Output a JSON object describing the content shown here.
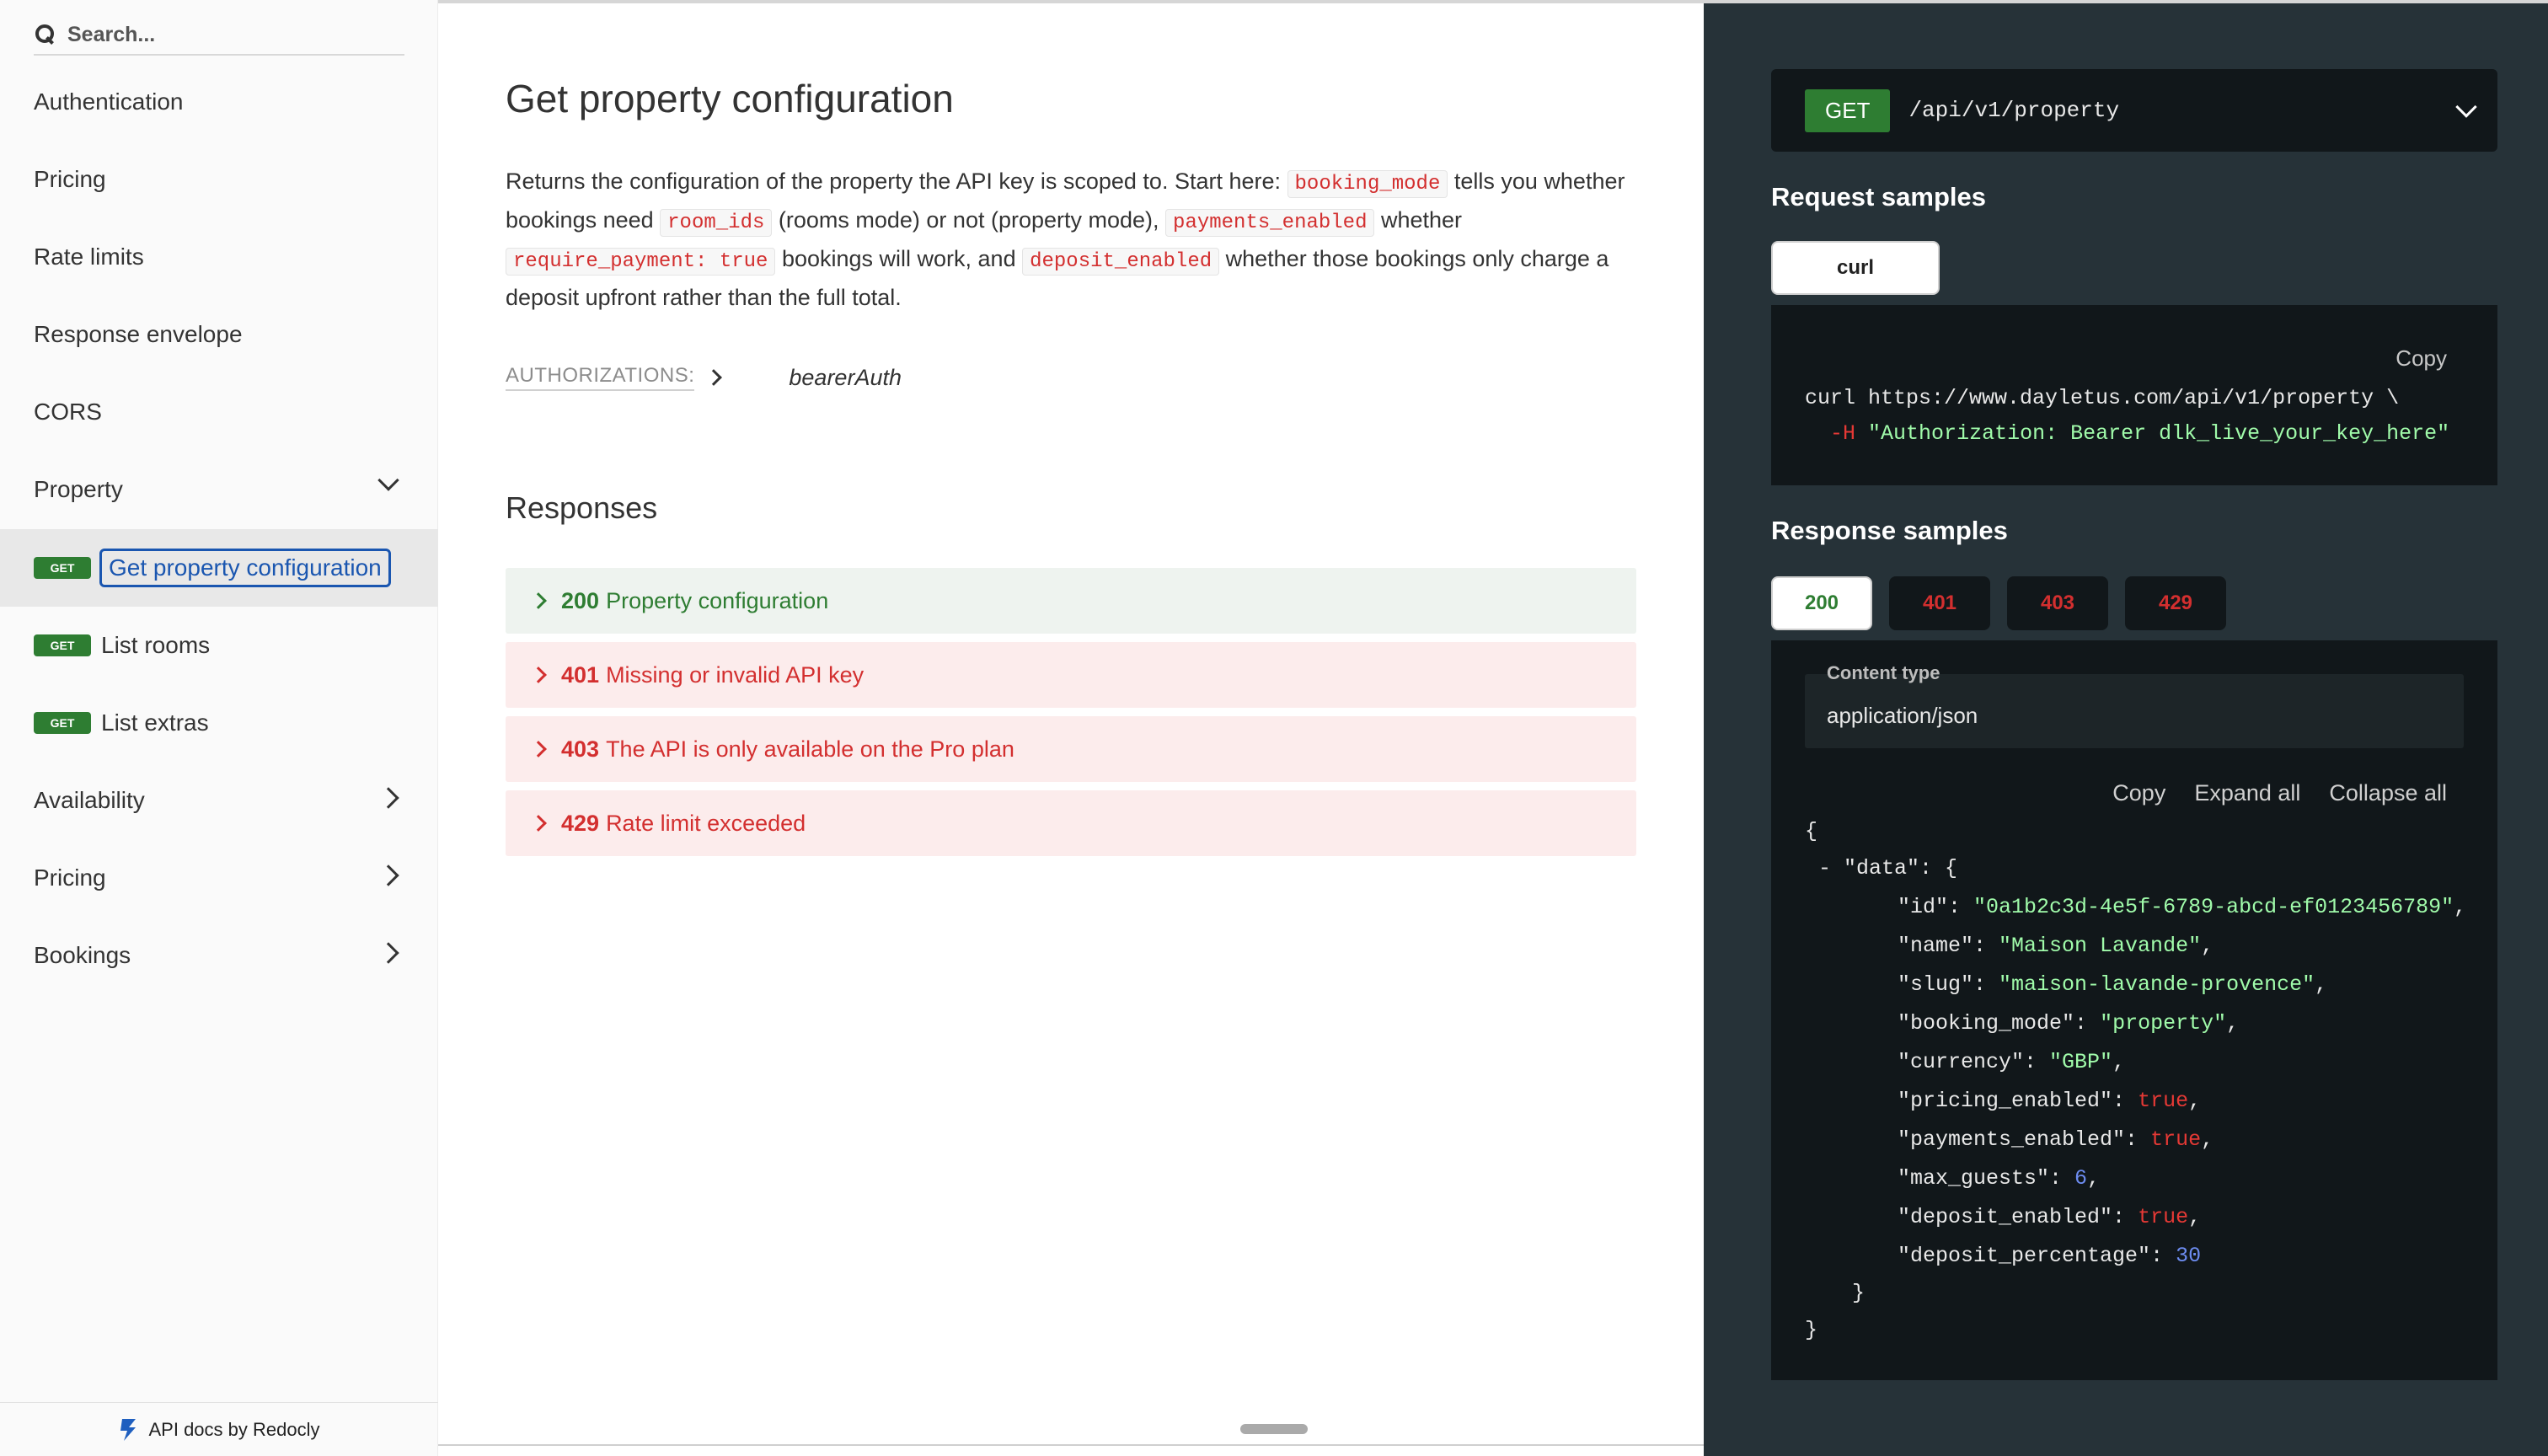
{
  "sidebar": {
    "search_placeholder": "Search...",
    "items": [
      {
        "label": "Authentication"
      },
      {
        "label": "Pricing"
      },
      {
        "label": "Rate limits"
      },
      {
        "label": "Response envelope"
      },
      {
        "label": "CORS"
      },
      {
        "label": "Property"
      },
      {
        "label": "Get property configuration",
        "method": "GET"
      },
      {
        "label": "List rooms",
        "method": "GET"
      },
      {
        "label": "List extras",
        "method": "GET"
      },
      {
        "label": "Availability"
      },
      {
        "label": "Pricing"
      },
      {
        "label": "Bookings"
      }
    ],
    "footer": "API docs by Redocly"
  },
  "main": {
    "title": "Get property configuration",
    "description": {
      "p1": "Returns the configuration of the property the API key is scoped to. Start here: ",
      "c1": "booking_mode",
      "p2": " tells you whether bookings need ",
      "c2": "room_ids",
      "p3": " (rooms mode) or not (property mode), ",
      "c3": "payments_enabled",
      "p4": " whether ",
      "c4": "require_payment: true",
      "p5": " bookings will work, and ",
      "c5": "deposit_enabled",
      "p6": " whether those bookings only charge a deposit upfront rather than the full total."
    },
    "authorizations_label": "AUTHORIZATIONS:",
    "authorizations_value": "bearerAuth",
    "responses_title": "Responses",
    "responses": [
      {
        "code": "200",
        "label": "Property configuration"
      },
      {
        "code": "401",
        "label": "Missing or invalid API key"
      },
      {
        "code": "403",
        "label": "The API is only available on the Pro plan"
      },
      {
        "code": "429",
        "label": "Rate limit exceeded"
      }
    ]
  },
  "right": {
    "method": "GET",
    "path": "/api/v1/property",
    "request_samples_title": "Request samples",
    "request_tab": "curl",
    "copy_label": "Copy",
    "curl_line1": "curl https://www.dayletus.com/api/v1/property \\",
    "curl_flag": "-H",
    "curl_header": "\"Authorization: Bearer dlk_live_your_key_here\"",
    "response_samples_title": "Response samples",
    "response_tabs": [
      "200",
      "401",
      "403",
      "429"
    ],
    "content_type_label": "Content type",
    "content_type_value": "application/json",
    "json_copy": "Copy",
    "expand_all": "Expand all",
    "collapse_all": "Collapse all",
    "json": {
      "open": "{",
      "data_key": "\"data\"",
      "data_open": ": {",
      "fields": [
        {
          "key": "\"id\"",
          "value": "\"0a1b2c3d-4e5f-6789-abcd-ef0123456789\"",
          "kind": "string",
          "comma": ","
        },
        {
          "key": "\"name\"",
          "value": "\"Maison Lavande\"",
          "kind": "string",
          "comma": ","
        },
        {
          "key": "\"slug\"",
          "value": "\"maison-lavande-provence\"",
          "kind": "string",
          "comma": ","
        },
        {
          "key": "\"booking_mode\"",
          "value": "\"property\"",
          "kind": "string",
          "comma": ","
        },
        {
          "key": "\"currency\"",
          "value": "\"GBP\"",
          "kind": "string",
          "comma": ","
        },
        {
          "key": "\"pricing_enabled\"",
          "value": "true",
          "kind": "bool",
          "comma": ","
        },
        {
          "key": "\"payments_enabled\"",
          "value": "true",
          "kind": "bool",
          "comma": ","
        },
        {
          "key": "\"max_guests\"",
          "value": "6",
          "kind": "number",
          "comma": ","
        },
        {
          "key": "\"deposit_enabled\"",
          "value": "true",
          "kind": "bool",
          "comma": ","
        },
        {
          "key": "\"deposit_percentage\"",
          "value": "30",
          "kind": "number",
          "comma": ""
        }
      ],
      "inner_close": "}",
      "close": "}"
    }
  }
}
